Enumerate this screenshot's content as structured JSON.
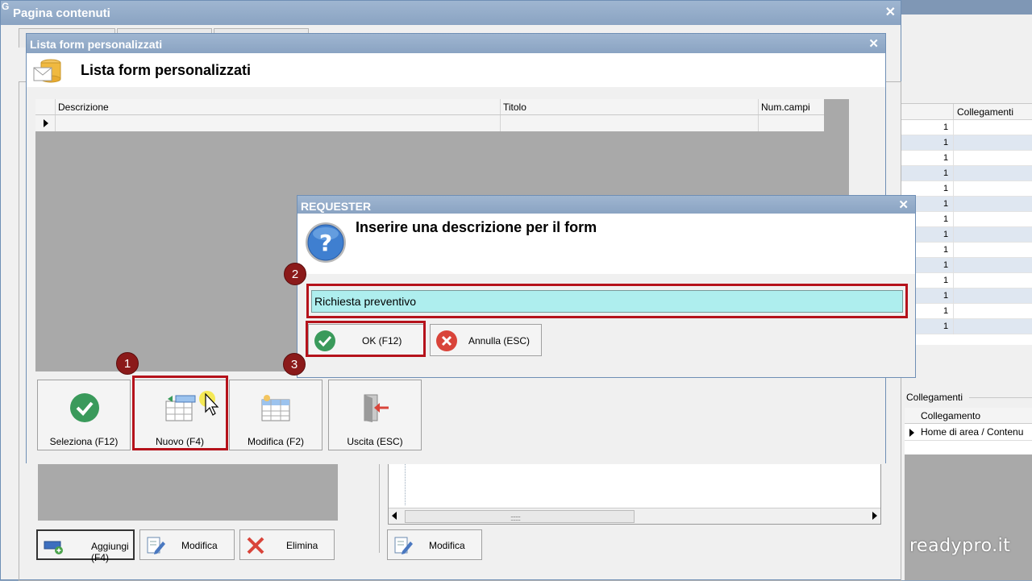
{
  "background_app": {
    "grid_header": "Collegamenti",
    "grid_values": [
      "1",
      "1",
      "1",
      "1",
      "1",
      "1",
      "1",
      "1",
      "1",
      "1",
      "1",
      "1",
      "1",
      "1"
    ],
    "links_group_label": "Collegamenti",
    "links_grid_header": "Collegamento",
    "links_grid_row": "Home di area / Contenu"
  },
  "window_pagina": {
    "title": "Pagina contenuti",
    "close_glyph": "✕",
    "corner_letter": "G",
    "left_buttons": {
      "add_label": "Aggiungi (F4)",
      "edit_label": "Modifica",
      "delete_label": "Elimina"
    },
    "mid_buttons": {
      "edit_label": "Modifica"
    },
    "scroll_grip": "::::::::"
  },
  "window_lista": {
    "title": "Lista form personalizzati",
    "header_title": "Lista form personalizzati",
    "close_glyph": "✕",
    "grid": {
      "columns": [
        "Descrizione",
        "Titolo",
        "Num.campi"
      ],
      "rows": [
        [
          "",
          "",
          ""
        ]
      ]
    },
    "buttons": {
      "select_label": "Seleziona (F12)",
      "new_label": "Nuovo (F4)",
      "edit_label": "Modifica (F2)",
      "exit_label": "Uscita (ESC)"
    }
  },
  "dialog_requester": {
    "title": "REQUESTER",
    "close_glyph": "✕",
    "prompt": "Inserire una descrizione per il form",
    "input_value": "Richiesta preventivo",
    "ok_label": "OK (F12)",
    "cancel_label": "Annulla (ESC)"
  },
  "tutorial_markers": [
    "1",
    "2",
    "3"
  ],
  "watermark": "readypro.it",
  "colors": {
    "titlebar": "#8aa3c2",
    "highlight": "#b5121b",
    "marker": "#8b1a1a",
    "input_bg": "#aeeeee",
    "ok_green": "#3a9a5b",
    "cancel_red": "#d9443a"
  }
}
